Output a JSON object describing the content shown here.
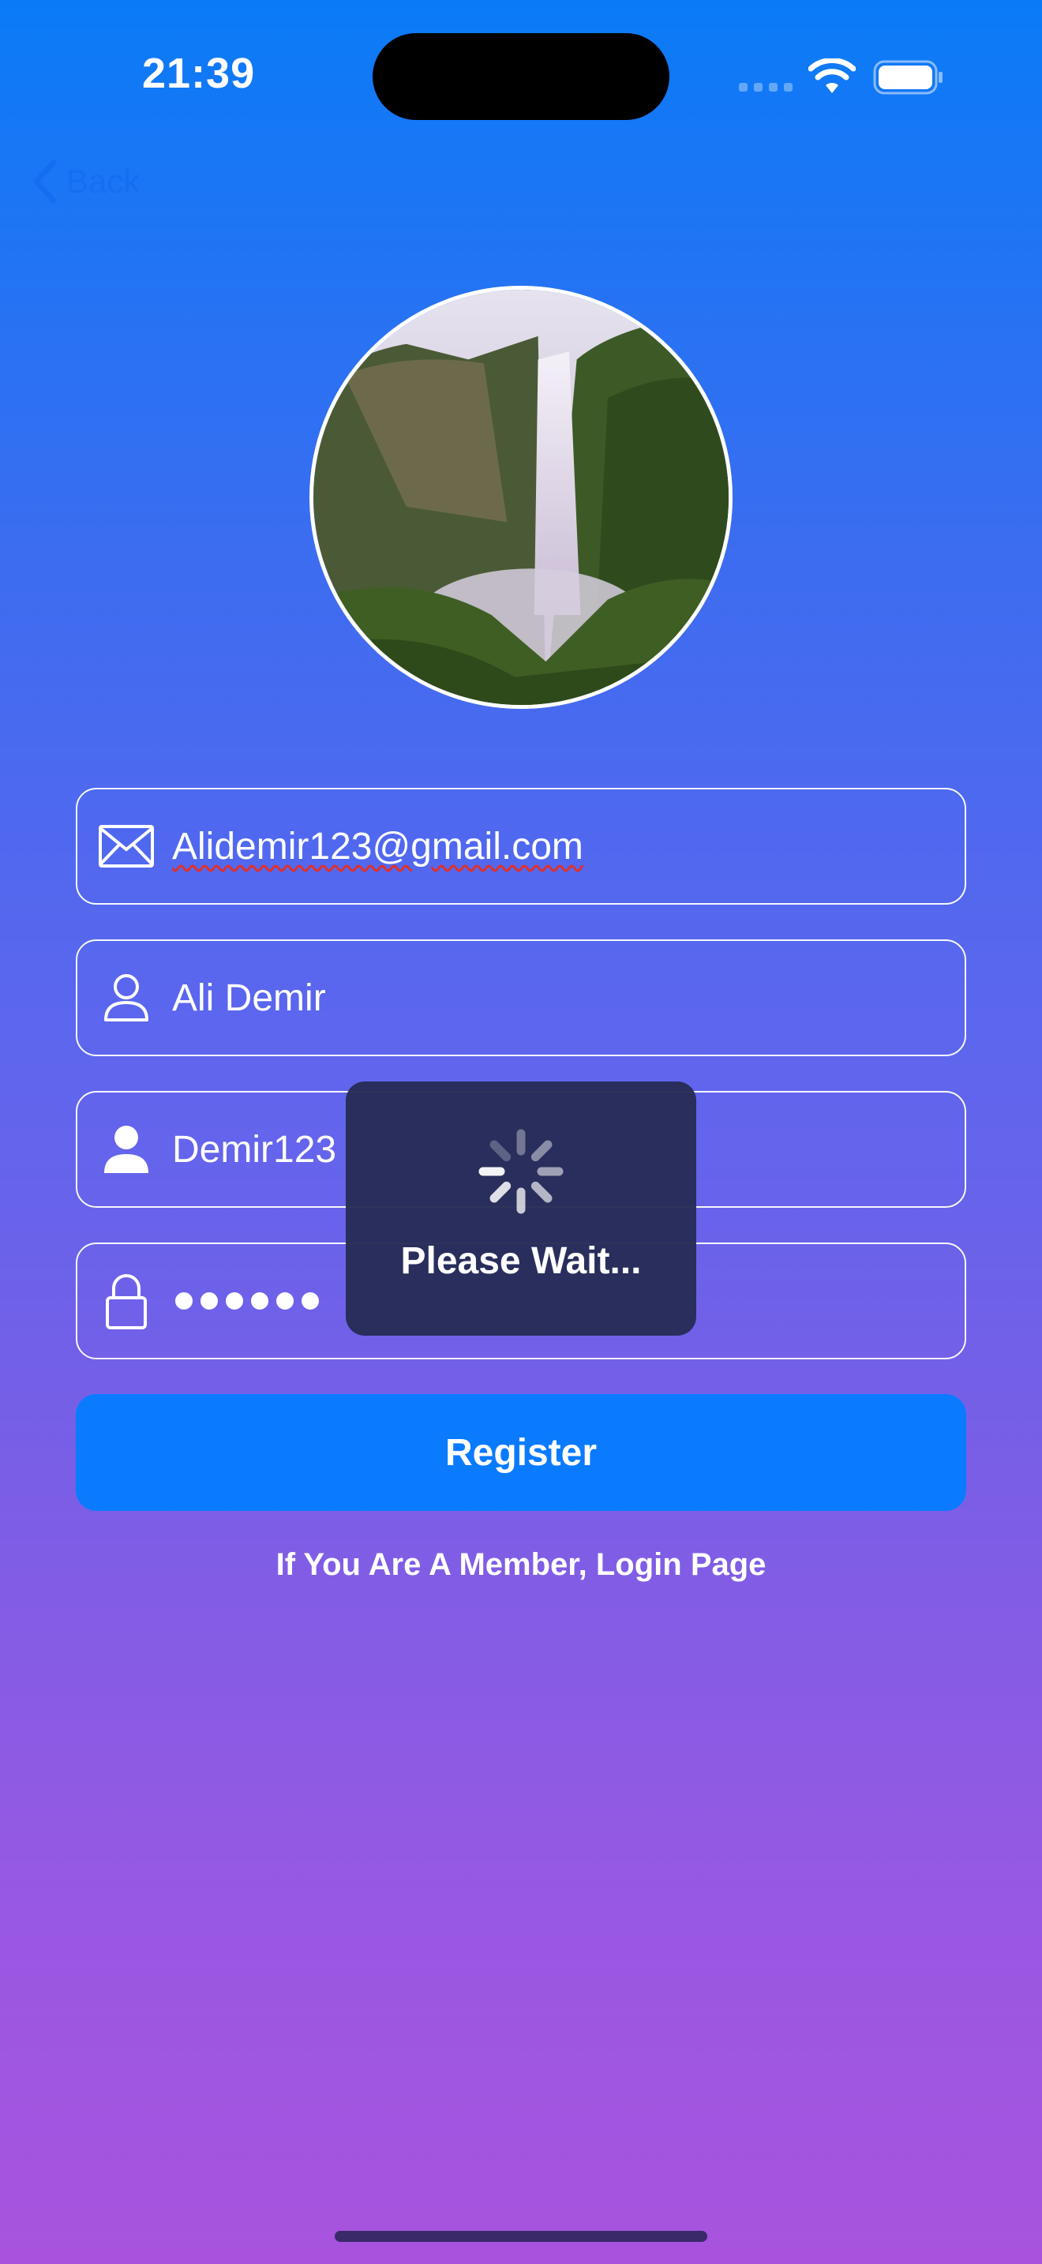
{
  "status_bar": {
    "time": "21:39",
    "signal_icon": "cellular-signal-icon",
    "wifi_icon": "wifi-icon",
    "battery_icon": "battery-icon"
  },
  "nav": {
    "back_label": "Back",
    "back_icon": "chevron-left-icon"
  },
  "profile": {
    "image_description_icon": "profile-photo"
  },
  "form": {
    "email": {
      "icon": "envelope-icon",
      "value": "Alidemir123@gmail.com"
    },
    "name": {
      "icon": "person-outline-icon",
      "value": "Ali Demir"
    },
    "username": {
      "icon": "person-fill-icon",
      "value": "Demir123"
    },
    "password": {
      "icon": "lock-icon",
      "masked_length": 6
    }
  },
  "register_label": "Register",
  "login_link": "If You Are A Member, Login Page",
  "loading": {
    "text": "Please Wait...",
    "icon": "spinner-icon"
  },
  "colors": {
    "accent": "#0A7BFF",
    "gradient_top": "#0A7BF7",
    "gradient_bottom": "#A853DE",
    "hud": "#262C55"
  }
}
